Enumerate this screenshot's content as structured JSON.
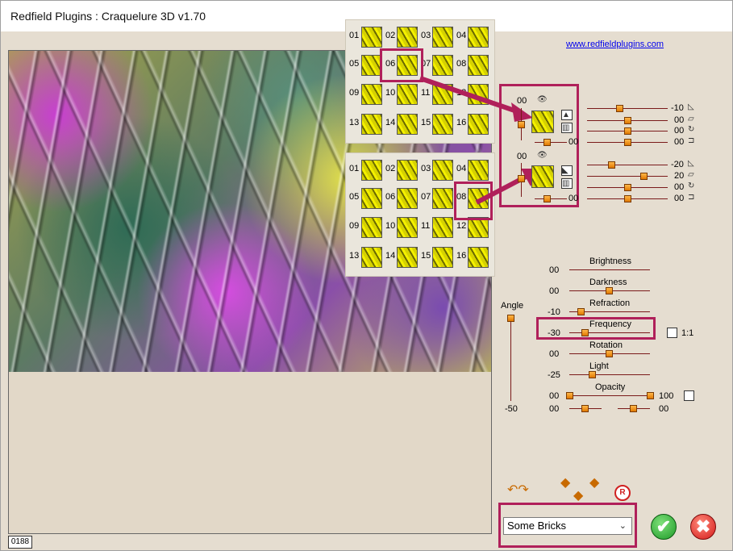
{
  "window": {
    "title": "Redfield Plugins : Craquelure 3D  v1.70"
  },
  "link": "www.redfieldplugins.com",
  "preview": {
    "counter": "0188"
  },
  "pattern_grid": {
    "numbers": [
      "01",
      "02",
      "03",
      "04",
      "05",
      "06",
      "07",
      "08",
      "09",
      "10",
      "11",
      "12",
      "13",
      "14",
      "15",
      "16"
    ]
  },
  "layers": {
    "top": {
      "value": "00",
      "sliders": [
        "-10",
        "00",
        "00",
        "00"
      ]
    },
    "bottom": {
      "value": "00",
      "sliders": [
        "-20",
        "20",
        "00",
        "00"
      ]
    }
  },
  "angle": {
    "label": "Angle",
    "value": "-50"
  },
  "params": [
    {
      "label": "Brightness",
      "value": "00"
    },
    {
      "label": "Darkness",
      "value": "00"
    },
    {
      "label": "Refraction",
      "value": "-10"
    },
    {
      "label": "Frequency",
      "value": "-30"
    },
    {
      "label": "Rotation",
      "value": "00"
    },
    {
      "label": "Light",
      "value": "-25"
    },
    {
      "label": "Opacity",
      "value": "00"
    }
  ],
  "opacity_max": "100",
  "extra_row": {
    "left": "00",
    "right": "00"
  },
  "ratio_label": "1:1",
  "preset": {
    "selected": "Some Bricks"
  },
  "buttons": {
    "ok": "✔",
    "cancel": "✖",
    "r_badge": "R"
  }
}
